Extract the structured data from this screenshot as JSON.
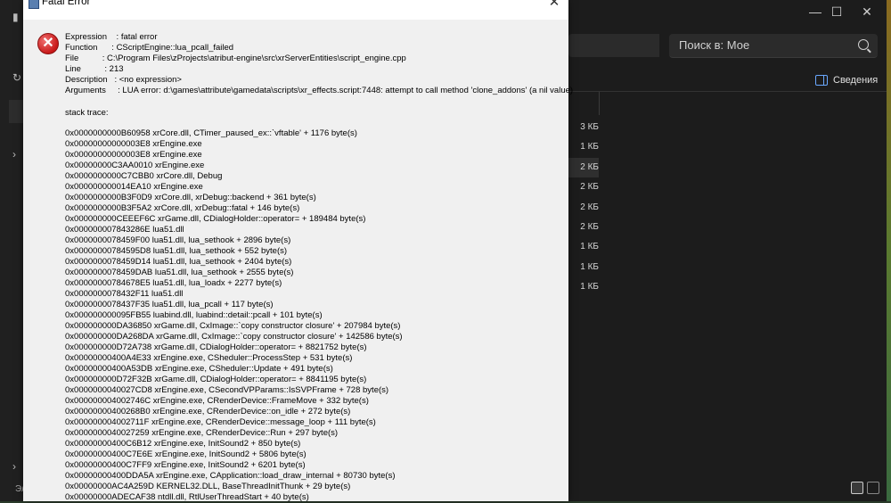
{
  "dialog": {
    "title": "Fatal Error",
    "close_glyph": "✕",
    "icon": "error-icon",
    "info": [
      {
        "label": "Expression",
        "sep": "    : ",
        "value": "fatal error"
      },
      {
        "label": "Function",
        "sep": "      : ",
        "value": "CScriptEngine::lua_pcall_failed"
      },
      {
        "label": "File",
        "sep": "          : ",
        "value": "C:\\Program Files\\zProjects\\atribut-engine\\src\\xrServerEntities\\script_engine.cpp"
      },
      {
        "label": "Line",
        "sep": "          : ",
        "value": "213"
      },
      {
        "label": "Description",
        "sep": "   : ",
        "value": "<no expression>"
      },
      {
        "label": "Arguments",
        "sep": "     : ",
        "value": "LUA error: d:\\games\\attribute\\gamedata\\scripts\\xr_effects.script:7448: attempt to call method 'clone_addons' (a nil value)"
      }
    ],
    "stack_title": "stack trace:",
    "stack": [
      "0x0000000000B60958 xrCore.dll, CTimer_paused_ex::`vftable' + 1176 byte(s)",
      "0x00000000000003E8 xrEngine.exe",
      "0x00000000000003E8 xrEngine.exe",
      "0x00000000C3AA0010 xrEngine.exe",
      "0x0000000000C7CBB0 xrCore.dll, Debug",
      "0x000000000014EA10 xrEngine.exe",
      "0x0000000000B3F0D9 xrCore.dll, xrDebug::backend + 361 byte(s)",
      "0x0000000000B3F5A2 xrCore.dll, xrDebug::fatal + 146 byte(s)",
      "0x000000000CEEEF6C xrGame.dll, CDialogHolder::operator= + 189484 byte(s)",
      "0x000000007843286E lua51.dll",
      "0x0000000078459F00 lua51.dll, lua_sethook + 2896 byte(s)",
      "0x00000000784595D8 lua51.dll, lua_sethook + 552 byte(s)",
      "0x0000000078459D14 lua51.dll, lua_sethook + 2404 byte(s)",
      "0x0000000078459DAB lua51.dll, lua_sethook + 2555 byte(s)",
      "0x00000000784678E5 lua51.dll, lua_loadx + 2277 byte(s)",
      "0x0000000078432F11 lua51.dll",
      "0x0000000078437F35 lua51.dll, lua_pcall + 117 byte(s)",
      "0x000000000095FB55 luabind.dll, luabind::detail::pcall + 101 byte(s)",
      "0x000000000DA36850 xrGame.dll, CxImage::`copy constructor closure' + 207984 byte(s)",
      "0x000000000DA268DA xrGame.dll, CxImage::`copy constructor closure' + 142586 byte(s)",
      "0x000000000D72A738 xrGame.dll, CDialogHolder::operator= + 8821752 byte(s)",
      "0x00000000400A4E33 xrEngine.exe, CSheduler::ProcessStep + 531 byte(s)",
      "0x00000000400A53DB xrEngine.exe, CSheduler::Update + 491 byte(s)",
      "0x000000000D72F32B xrGame.dll, CDialogHolder::operator= + 8841195 byte(s)",
      "0x0000000040027CD8 xrEngine.exe, CSecondVPParams::IsSVPFrame + 728 byte(s)",
      "0x000000004002746C xrEngine.exe, CRenderDevice::FrameMove + 332 byte(s)",
      "0x00000000400268B0 xrEngine.exe, CRenderDevice::on_idle + 272 byte(s)",
      "0x000000004002711F xrEngine.exe, CRenderDevice::message_loop + 111 byte(s)",
      "0x0000000040027259 xrEngine.exe, CRenderDevice::Run + 297 byte(s)",
      "0x00000000400C6B12 xrEngine.exe, InitSound2 + 850 byte(s)",
      "0x00000000400C7E6E xrEngine.exe, InitSound2 + 5806 byte(s)",
      "0x00000000400C7FF9 xrEngine.exe, InitSound2 + 6201 byte(s)",
      "0x00000000400DDA5A xrEngine.exe, CApplication::load_draw_internal + 80730 byte(s)",
      "0x00000000AC4A259D KERNEL32.DLL, BaseThreadInitThunk + 29 byte(s)",
      "0x00000000ADECAF38 ntdll.dll, RtlUserThreadStart + 40 byte(s)"
    ]
  },
  "explorer": {
    "search_placeholder": "Поиск в: Мое",
    "details_label": "Сведения",
    "minimize_glyph": "—",
    "maximize_glyph": "☐",
    "close_glyph": "✕",
    "sizes": [
      "3 КБ",
      "1 КБ",
      "2 КБ",
      "2 КБ",
      "2 КБ",
      "2 КБ",
      "1 КБ",
      "1 КБ",
      "1 КБ"
    ],
    "selected_row": 2,
    "status_left": "Эл"
  }
}
